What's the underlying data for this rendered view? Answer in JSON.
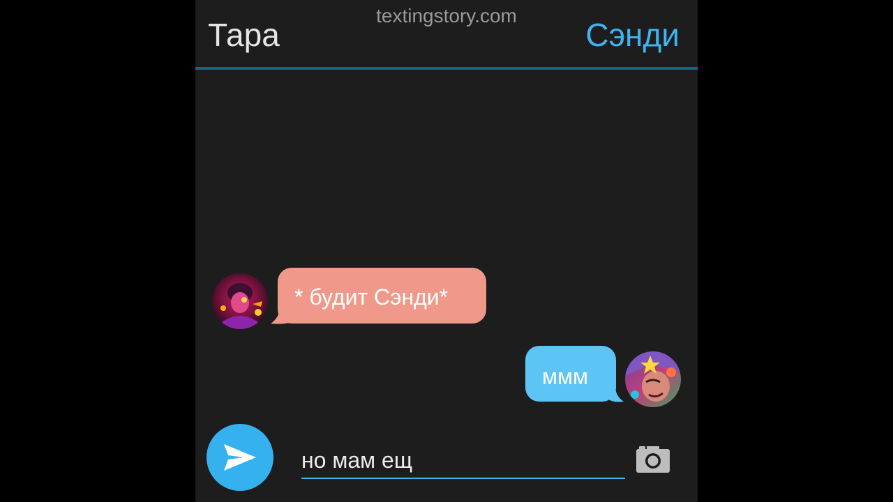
{
  "header": {
    "left_name": "Тара",
    "right_name": "Сэнди",
    "watermark": "textingstory.com"
  },
  "messages": [
    {
      "side": "left",
      "text": "* будит Сэнди*",
      "color": "#f0998a"
    },
    {
      "side": "right",
      "text": "ммм",
      "color": "#5cc5f6"
    }
  ],
  "composer": {
    "input_value": "но мам ещ",
    "send_icon": "send-icon",
    "camera_icon": "camera-icon"
  },
  "colors": {
    "accent": "#36b1ef",
    "header_line": "#17648a",
    "background": "#1d1d1d"
  }
}
